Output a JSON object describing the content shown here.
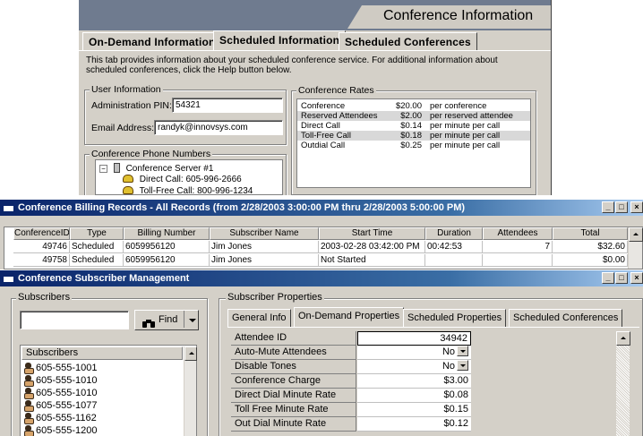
{
  "conf_info": {
    "title": "Conference Information",
    "tabs": [
      "On-Demand Information",
      "Scheduled Information",
      "Scheduled Conferences"
    ],
    "description": "This tab provides information about your scheduled conference service.  For additional information about scheduled conferences, click the Help button below.",
    "user_info": {
      "group_label": "User Information",
      "pin_label": "Administration PIN:",
      "pin_value": "54321",
      "email_label": "Email Address:",
      "email_value": "randyk@innovsys.com"
    },
    "rates": {
      "group_label": "Conference Rates",
      "rows": [
        {
          "name": "Conference",
          "price": "$20.00",
          "unit": "per conference"
        },
        {
          "name": "Reserved Attendees",
          "price": "$2.00",
          "unit": "per reserved attendee"
        },
        {
          "name": "Direct Call",
          "price": "$0.14",
          "unit": "per minute per call"
        },
        {
          "name": "Toll-Free Call",
          "price": "$0.18",
          "unit": "per minute per call"
        },
        {
          "name": "Outdial Call",
          "price": "$0.25",
          "unit": "per minute per call"
        }
      ]
    },
    "phone_numbers": {
      "group_label": "Conference Phone Numbers",
      "server": "Conference Server #1",
      "direct": "Direct Call: 605-996-2666",
      "tollfree": "Toll-Free Call: 800-996-1234"
    }
  },
  "billing": {
    "title": "Conference Billing Records - All Records (from 2/28/2003 3:00:00 PM thru 2/28/2003 5:00:00 PM)",
    "columns": [
      "ConferenceID",
      "Type",
      "Billing Number",
      "Subscriber Name",
      "Start Time",
      "Duration",
      "Attendees",
      "Total"
    ],
    "rows": [
      [
        "49746",
        "Scheduled",
        "6059956120",
        "Jim Jones",
        "2003-02-28 03:42:00 PM",
        "00:42:53",
        "7",
        "$32.60"
      ],
      [
        "49758",
        "Scheduled",
        "6059956120",
        "Jim Jones",
        "Not Started",
        "",
        "",
        "$0.00"
      ]
    ]
  },
  "subscriber_mgmt": {
    "title": "Conference Subscriber Management",
    "subscribers_group": "Subscribers",
    "find_label": "Find",
    "search_value": "",
    "list_header": "Subscribers",
    "subscribers": [
      "605-555-1001",
      "605-555-1010",
      "605-555-1010",
      "605-555-1077",
      "605-555-1162",
      "605-555-1200"
    ],
    "properties_group": "Subscriber Properties",
    "tabs": [
      "General Info",
      "On-Demand Properties",
      "Scheduled Properties",
      "Scheduled Conferences"
    ],
    "properties": [
      {
        "label": "Attendee ID",
        "value": "34942"
      },
      {
        "label": "Auto-Mute Attendees",
        "value": "No"
      },
      {
        "label": "Disable Tones",
        "value": "No"
      },
      {
        "label": "Conference Charge",
        "value": "$3.00"
      },
      {
        "label": "Direct Dial Minute Rate",
        "value": "$0.08"
      },
      {
        "label": "Toll Free Minute Rate",
        "value": "$0.15"
      },
      {
        "label": "Out Dial Minute Rate",
        "value": "$0.12"
      }
    ]
  },
  "window_buttons": {
    "minimize": "_",
    "maximize": "□",
    "close": "×"
  }
}
